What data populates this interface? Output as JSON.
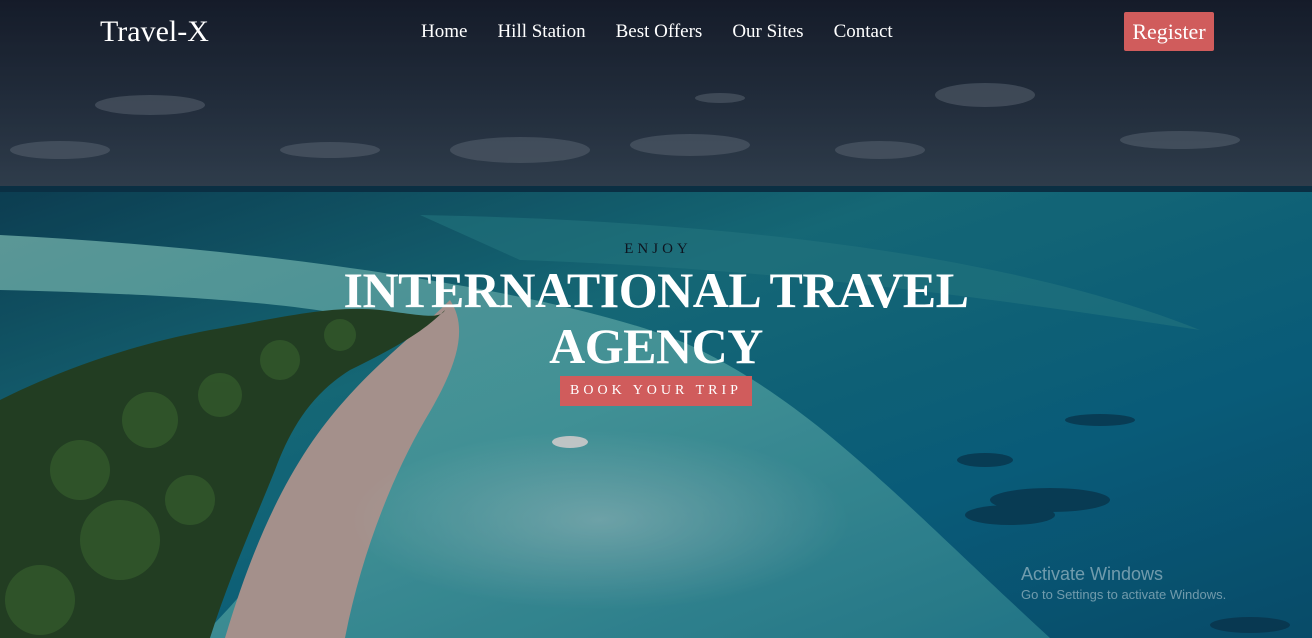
{
  "nav": {
    "logo": "Travel-X",
    "links": [
      "Home",
      "Hill Station",
      "Best Offers",
      "Our Sites",
      "Contact"
    ],
    "register_label": "Register"
  },
  "hero": {
    "eyebrow": "ENJOY",
    "headline": "INTERNATIONAL TRAVEL AGENCY",
    "cta_label": "BOOK YOUR TRIP"
  },
  "watermark": {
    "title": "Activate Windows",
    "subtitle": "Go to Settings to activate Windows."
  },
  "colors": {
    "accent": "#d05c5c",
    "nav_text": "#ffffff",
    "eyebrow_text": "#0e1520"
  }
}
